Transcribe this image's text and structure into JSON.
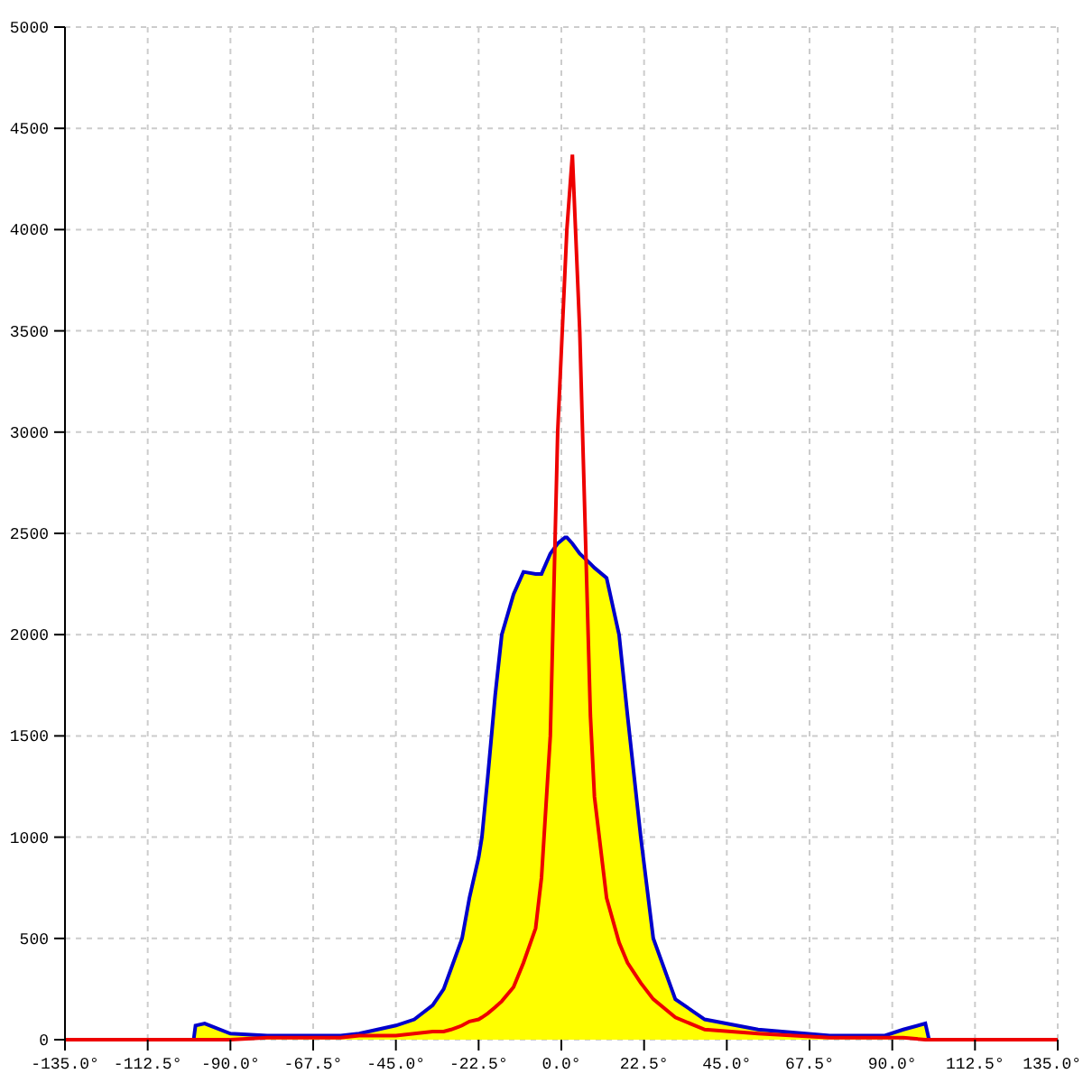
{
  "chart_data": {
    "type": "area",
    "x": [
      -135,
      -100,
      -99.5,
      -97,
      -90,
      -80,
      -67.5,
      -60,
      -55,
      -45,
      -40,
      -35,
      -32,
      -30,
      -27,
      -25,
      -22.5,
      -21.6,
      -20,
      -18,
      -16.2,
      -13,
      -10.3,
      -7,
      -5.4,
      -3,
      -1,
      1,
      1.5,
      3,
      5,
      7.9,
      9,
      12.3,
      15.7,
      18,
      21.6,
      25,
      31,
      39,
      53.5,
      73,
      88,
      93,
      99,
      100,
      135
    ],
    "series": [
      {
        "color": "#ffff00",
        "values": [
          null,
          0,
          70,
          80,
          30,
          20,
          20,
          20,
          30,
          70,
          100,
          170,
          250,
          350,
          500,
          700,
          900,
          1000,
          1300,
          1700,
          2000,
          2200,
          2310,
          2300,
          2300,
          2400,
          2450,
          2480,
          2480,
          2450,
          2400,
          2350,
          2330,
          2280,
          2000,
          1600,
          1000,
          500,
          200,
          100,
          50,
          20,
          20,
          50,
          80,
          0,
          null
        ]
      },
      {
        "color": "#ee0000",
        "type": "line",
        "values": [
          0,
          0,
          0,
          0,
          0,
          10,
          10,
          10,
          20,
          20,
          30,
          40,
          40,
          50,
          70,
          90,
          100,
          110,
          130,
          160,
          190,
          260,
          380,
          550,
          800,
          1500,
          3000,
          3800,
          4000,
          4370,
          3500,
          1600,
          1200,
          700,
          480,
          380,
          280,
          200,
          110,
          50,
          30,
          10,
          10,
          10,
          0,
          0,
          0
        ]
      }
    ],
    "grid": true,
    "xlim": [
      -135,
      135
    ],
    "ylim": [
      0,
      5000
    ],
    "xticks": [
      {
        "value": -135,
        "label": "-135.0°"
      },
      {
        "value": -112.5,
        "label": "-112.5°"
      },
      {
        "value": -90,
        "label": "-90.0°"
      },
      {
        "value": -67.5,
        "label": "-67.5°"
      },
      {
        "value": -45,
        "label": "-45.0°"
      },
      {
        "value": -22.5,
        "label": "-22.5°"
      },
      {
        "value": 0,
        "label": "0.0°"
      },
      {
        "value": 22.5,
        "label": "22.5°"
      },
      {
        "value": 45,
        "label": "45.0°"
      },
      {
        "value": 67.5,
        "label": "67.5°"
      },
      {
        "value": 90,
        "label": "90.0°"
      },
      {
        "value": 112.5,
        "label": "112.5°"
      },
      {
        "value": 135,
        "label": "135.0°"
      }
    ],
    "yticks": [
      0,
      500,
      1000,
      1500,
      2000,
      2500,
      3000,
      3500,
      4000,
      4500,
      5000
    ]
  }
}
